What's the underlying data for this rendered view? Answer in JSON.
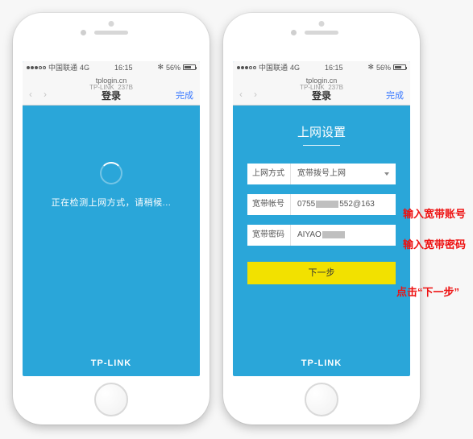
{
  "status": {
    "carrier": "中国联通",
    "network": "4G",
    "time": "16:15",
    "battery": "56%"
  },
  "nav": {
    "addr": "tplogin.cn",
    "sub": "TP-LINK_237B",
    "title": "登录",
    "done": "完成"
  },
  "left": {
    "loading": "正在检测上网方式，请稍候..."
  },
  "right": {
    "heading": "上网设置",
    "mode_label": "上网方式",
    "mode_value": "宽带拨号上网",
    "acct_label": "宽带帐号",
    "acct_prefix": "0755",
    "acct_suffix": "552@163",
    "pwd_label": "宽带密码",
    "pwd_prefix": "AIYAO",
    "next": "下一步"
  },
  "brand": "TP-LINK",
  "anno": {
    "acct": "输入宽带账号",
    "pwd": "输入宽带密码",
    "next": "点击“下一步”"
  }
}
